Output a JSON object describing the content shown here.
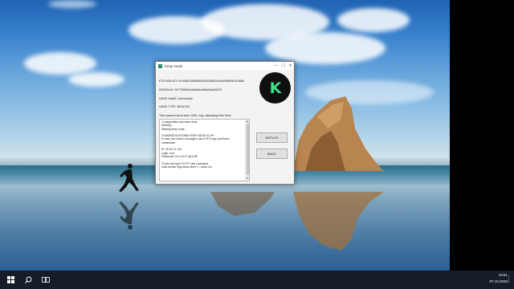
{
  "window": {
    "title": "Keep Node",
    "controls": {
      "minimize": "—",
      "maximize": "☐",
      "close": "✕"
    }
  },
  "info": {
    "eth_wallet": "ETH WALLET: 0x1f45914f45558d32b3380f21d03e4f9f4091f1488e",
    "infura_id": "INFURA ID: fb7735ff0b3e484fa6c9f6b0ddc00220",
    "node_name": "NODE NAME: DemoNode",
    "node_type": "NODE TYPE: BEACON",
    "time_passed": "Time passed since start: 262s. Avg. deploying time 5min."
  },
  "logo": {
    "letter": "K",
    "accent": "#3de08b"
  },
  "console": {
    "lines": [
      "-Configuration has been done.",
      "Starting...",
      "Starting keep node...",
      "",
      "CONGRATULATIONS! KEEP NODE IS UP!",
      "In case you want to manage it use PuTTy app and these",
      "credentials:",
      "",
      "IP: 45.32.71.120",
      "Login: root",
      "Password: 2+m-Yo-F+e[UL0$",
      "",
      "To see full log in PuTTY use command",
      "sudo docker logs keep-client -f --since 1m"
    ]
  },
  "buttons": {
    "deploy": "DEPLOY",
    "back": "BACK"
  },
  "taskbar": {
    "time": "16:51",
    "date": "07.10.2020"
  }
}
